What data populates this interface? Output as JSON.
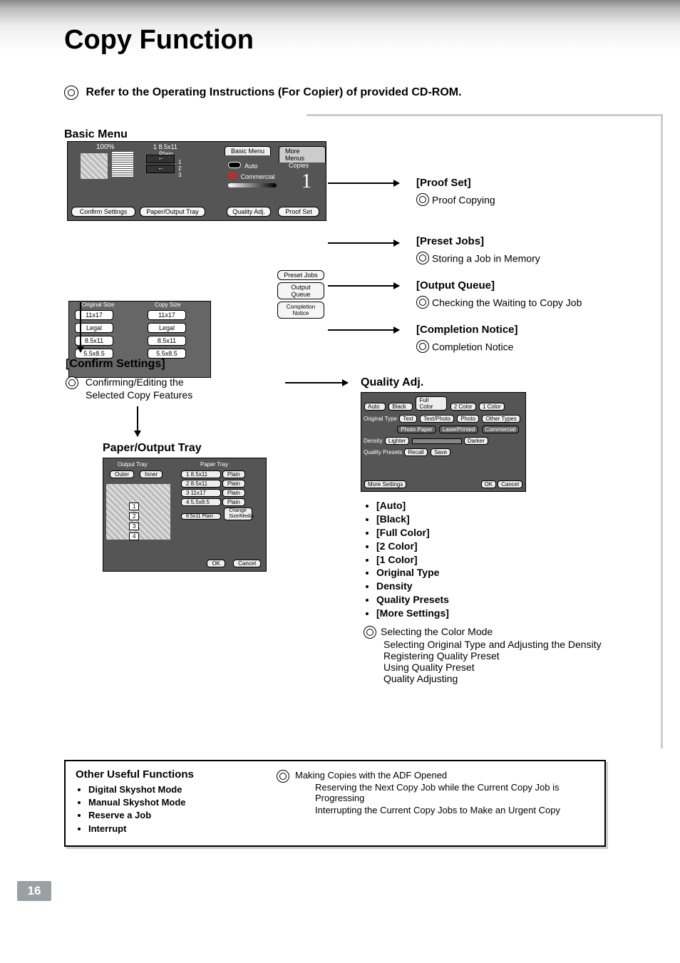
{
  "page_title": "Copy Function",
  "page_number": "16",
  "refer_line": "Refer to the Operating Instructions (For Copier) of provided CD-ROM.",
  "basic_menu_heading": "Basic Menu",
  "basic_menu": {
    "zoom": "100%",
    "paper_label": "1   8.5x11",
    "paper_type": "Plain",
    "tabs": {
      "basic": "Basic Menu",
      "more": "More Menus"
    },
    "auto": "Auto",
    "commercial": "Commercial",
    "copies_label": "Copies",
    "copies_value": "1",
    "btn_confirm": "Confirm Settings",
    "btn_paper": "Paper/Output Tray",
    "btn_quality": "Quality Adj.",
    "btn_proof": "Proof Set"
  },
  "size_panel": {
    "orig_label": "Original Size",
    "copy_label": "Copy Size",
    "sizes": [
      "11x17",
      "Legal",
      "8.5x11",
      "5.5x8.5"
    ]
  },
  "more_menus": {
    "preset": "Preset Jobs",
    "output": "Output Queue",
    "completion": "Completion Notice"
  },
  "callout_proof": {
    "h": "[Proof Set]",
    "d": "Proof Copying"
  },
  "callout_preset": {
    "h": "[Preset Jobs]",
    "d": "Storing a Job in Memory"
  },
  "callout_output": {
    "h": "[Output Queue]",
    "d": "Checking the Waiting to Copy Job"
  },
  "callout_completion": {
    "h": "[Completion Notice]",
    "d": "Completion Notice"
  },
  "confirm_settings": {
    "heading": "[Confirm Settings]",
    "desc1": "Confirming/Editing the",
    "desc2": "Selected Copy Features"
  },
  "paper_output": {
    "heading": "Paper/Output Tray",
    "output_tray": "Output Tray",
    "paper_tray": "Paper Tray",
    "outer": "Outer",
    "inner": "Inner",
    "row1": "1   8.5x11",
    "row1t": "Plain",
    "row2": "2   8.5x11",
    "row2t": "Plain",
    "row3": "3   11x17",
    "row3t": "Plain",
    "row4": "4   5.5x8.5",
    "row4t": "Plain",
    "row5": "8.5x11 Plain",
    "change": "Change Size/Media",
    "ok": "OK",
    "cancel": "Cancel"
  },
  "quality_adj": {
    "heading": "Quality Adj.",
    "modes": [
      "Auto",
      "Black",
      "Full Color",
      "2 Color",
      "1 Color"
    ],
    "orig_type": "Original Type",
    "types": [
      "Text",
      "Text/Photo",
      "Photo",
      "Other Types",
      "Photo Paper",
      "LaserPrinted",
      "Commercial"
    ],
    "density": "Density",
    "lighter": "Lighter",
    "darker": "Darker",
    "qp": "Quality Presets",
    "recall": "Recall",
    "save": "Save",
    "more": "More Settings",
    "ok": "OK",
    "cancel": "Cancel",
    "bullets": [
      "[Auto]",
      "[Black]",
      "[Full Color]",
      "[2 Color]",
      "[1 Color]",
      "Original Type",
      "Density",
      "Quality Presets",
      "[More Settings]"
    ],
    "desc": [
      "Selecting the Color Mode",
      "Selecting Original Type and Adjusting the Density",
      "Registering Quality Preset",
      "Using Quality Preset",
      "Quality Adjusting"
    ]
  },
  "other": {
    "heading": "Other Useful Functions",
    "items": [
      "Digital Skyshot Mode",
      "Manual Skyshot Mode",
      "Reserve a Job",
      "Interrupt"
    ],
    "right": [
      "Making Copies with the ADF Opened",
      "Reserving the Next Copy Job while the Current Copy Job is Progressing",
      "Interrupting the Current Copy Jobs to Make an Urgent Copy"
    ]
  }
}
